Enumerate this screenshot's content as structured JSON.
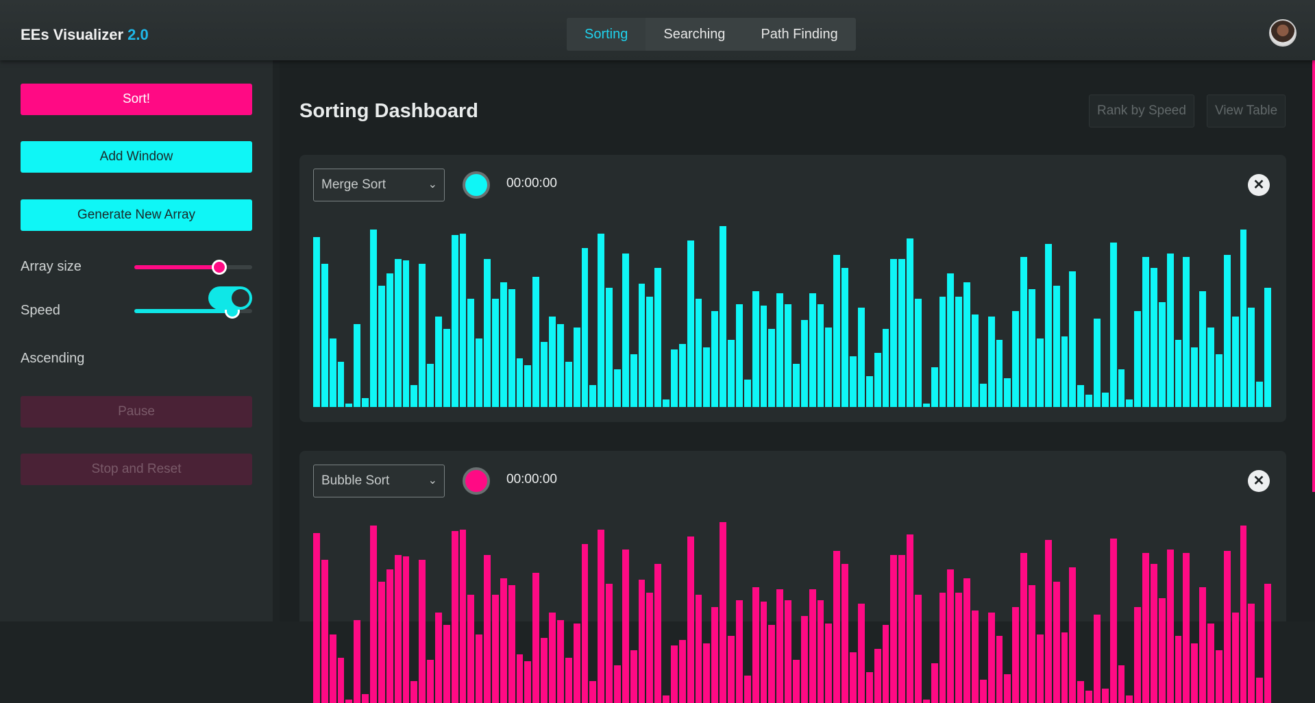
{
  "header": {
    "brand": "EEs Visualizer",
    "version": "2.0",
    "tabs": [
      "Sorting",
      "Searching",
      "Path Finding"
    ],
    "active_tab": 0
  },
  "sidebar": {
    "sort_label": "Sort!",
    "add_window_label": "Add Window",
    "generate_label": "Generate New Array",
    "array_size_label": "Array size",
    "array_size_value": 0.72,
    "speed_label": "Speed",
    "speed_value": 0.83,
    "ascending_label": "Ascending",
    "ascending_on": true,
    "pause_label": "Pause",
    "stop_label": "Stop and Reset"
  },
  "main": {
    "title": "Sorting Dashboard",
    "rank_label": "Rank by Speed",
    "table_label": "View Table"
  },
  "windows": [
    {
      "algorithm": "Merge Sort",
      "color": "#0ff6f6",
      "timer": "00:00:00"
    },
    {
      "algorithm": "Bubble Sort",
      "color": "#ff0a84",
      "timer": "00:00:00"
    }
  ],
  "array": [
    94,
    79,
    38,
    25,
    2,
    46,
    5,
    98,
    67,
    74,
    82,
    81,
    12,
    79,
    24,
    50,
    43,
    95,
    96,
    60,
    38,
    82,
    60,
    69,
    65,
    27,
    23,
    72,
    36,
    50,
    46,
    25,
    44,
    88,
    12,
    96,
    66,
    21,
    85,
    29,
    68,
    61,
    77,
    4,
    32,
    35,
    92,
    60,
    33,
    53,
    100,
    37,
    57,
    15,
    64,
    56,
    43,
    63,
    57,
    24,
    48,
    63,
    57,
    44,
    84,
    77,
    28,
    55,
    17,
    30,
    43,
    82,
    82,
    93,
    60,
    2,
    22,
    61,
    74,
    61,
    69,
    51,
    13,
    50,
    37,
    16,
    53,
    83,
    65,
    38,
    90,
    67,
    39,
    75,
    12,
    7,
    49,
    8,
    91,
    21,
    4,
    53,
    83,
    77,
    58,
    85,
    37,
    83,
    33,
    64,
    44,
    29,
    84,
    50,
    98,
    55,
    14,
    66
  ]
}
